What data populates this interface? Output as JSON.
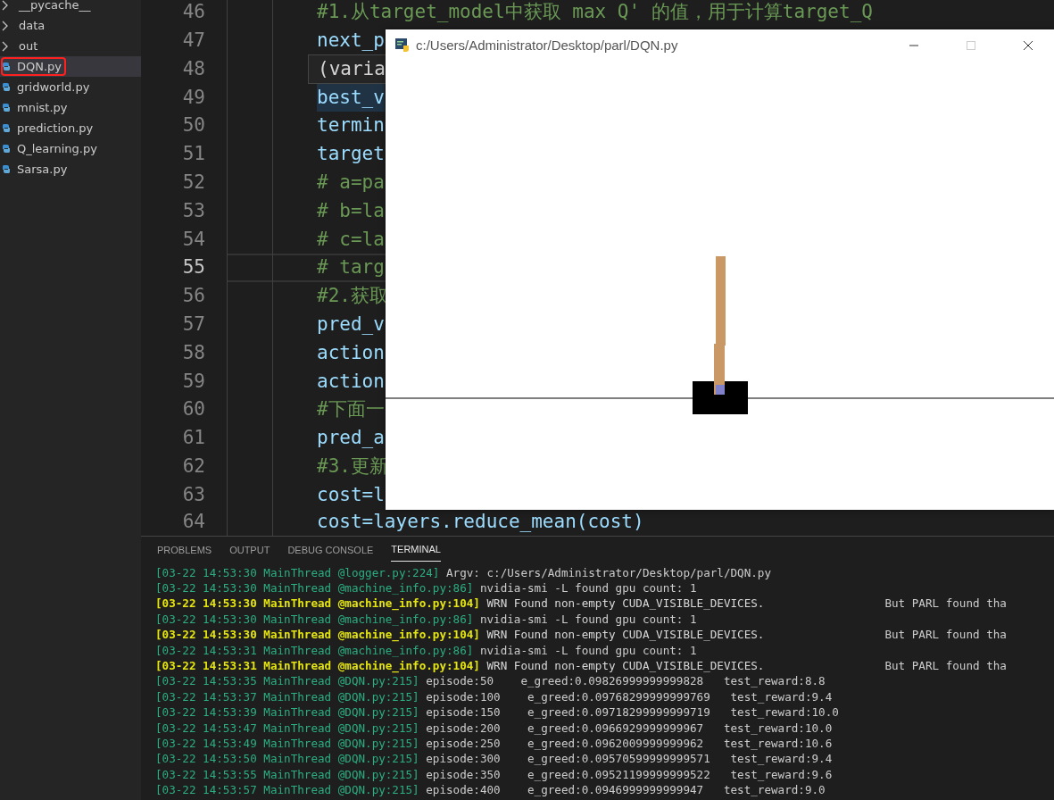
{
  "sidebar": {
    "items": [
      {
        "label": "__pycache__",
        "kind": "folder",
        "selected": false,
        "marked": false
      },
      {
        "label": "data",
        "kind": "folder",
        "selected": false,
        "marked": false
      },
      {
        "label": "out",
        "kind": "folder",
        "selected": false,
        "marked": false
      },
      {
        "label": "DQN.py",
        "kind": "python",
        "selected": true,
        "marked": true
      },
      {
        "label": "gridworld.py",
        "kind": "python",
        "selected": false,
        "marked": false
      },
      {
        "label": "mnist.py",
        "kind": "python",
        "selected": false,
        "marked": false
      },
      {
        "label": "prediction.py",
        "kind": "python",
        "selected": false,
        "marked": false
      },
      {
        "label": "Q_learning.py",
        "kind": "python",
        "selected": false,
        "marked": false
      },
      {
        "label": "Sarsa.py",
        "kind": "python",
        "selected": false,
        "marked": false
      }
    ]
  },
  "editor": {
    "lines": [
      {
        "number": "46",
        "text": "#1.从target_model中获取 max Q' 的值，用于计算target_Q",
        "kind": "comment",
        "highlighted": false,
        "current": false
      },
      {
        "number": "47",
        "text": "next_p",
        "kind": "code",
        "highlighted": false,
        "current": false
      },
      {
        "number": "48",
        "text": "(varia",
        "kind": "hover",
        "highlighted": false,
        "current": false
      },
      {
        "number": "49",
        "text": "best_v",
        "kind": "code",
        "highlighted": true,
        "current": false
      },
      {
        "number": "50",
        "text": "termin",
        "kind": "code",
        "highlighted": false,
        "current": false
      },
      {
        "number": "51",
        "text": "target",
        "kind": "code",
        "highlighted": false,
        "current": false
      },
      {
        "number": "52",
        "text": "# a=pa",
        "kind": "comment",
        "highlighted": false,
        "current": false
      },
      {
        "number": "53",
        "text": "# b=la",
        "kind": "comment",
        "highlighted": false,
        "current": false
      },
      {
        "number": "54",
        "text": "# c=la",
        "kind": "comment",
        "highlighted": false,
        "current": false
      },
      {
        "number": "55",
        "text": "# targ",
        "kind": "comment",
        "highlighted": false,
        "current": true
      },
      {
        "number": "56",
        "text": "#2.获取",
        "kind": "comment",
        "highlighted": false,
        "current": false
      },
      {
        "number": "57",
        "text": "pred_v",
        "kind": "code",
        "highlighted": false,
        "current": false
      },
      {
        "number": "58",
        "text": "action",
        "kind": "code",
        "highlighted": false,
        "current": false
      },
      {
        "number": "59",
        "text": "action",
        "kind": "code",
        "highlighted": false,
        "current": false
      },
      {
        "number": "60",
        "text": "#下面一",
        "kind": "comment",
        "highlighted": false,
        "current": false
      },
      {
        "number": "61",
        "text": "pred_a",
        "kind": "code",
        "highlighted": false,
        "current": false
      },
      {
        "number": "62",
        "text": "#3.更新",
        "kind": "comment",
        "highlighted": false,
        "current": false
      },
      {
        "number": "63",
        "text": "cost=l",
        "kind": "code",
        "highlighted": false,
        "current": false
      },
      {
        "number": "64",
        "text": "cost=layers.reduce_mean(cost)",
        "kind": "code",
        "highlighted": false,
        "current": false
      }
    ]
  },
  "app_window": {
    "title": "c:/Users/Administrator/Desktop/parl/DQN.py"
  },
  "panel": {
    "tabs": [
      {
        "label": "PROBLEMS",
        "selected": false
      },
      {
        "label": "OUTPUT",
        "selected": false
      },
      {
        "label": "DEBUG CONSOLE",
        "selected": false
      },
      {
        "label": "TERMINAL",
        "selected": true
      }
    ],
    "terminal": [
      {
        "kind": "info",
        "prefix": "[03-22 14:53:30 MainThread @logger.py:224]",
        "message": "Argv: c:/Users/Administrator/Desktop/parl/DQN.py"
      },
      {
        "kind": "info",
        "prefix": "[03-22 14:53:30 MainThread @machine_info.py:86]",
        "message": "nvidia-smi -L found gpu count: 1"
      },
      {
        "kind": "warn",
        "prefix": "[03-22 14:53:30 MainThread @machine_info.py:104]",
        "message": "WRN Found non-empty CUDA_VISIBLE_DEVICES.",
        "extra": "But PARL found tha"
      },
      {
        "kind": "info",
        "prefix": "[03-22 14:53:30 MainThread @machine_info.py:86]",
        "message": "nvidia-smi -L found gpu count: 1"
      },
      {
        "kind": "warn",
        "prefix": "[03-22 14:53:30 MainThread @machine_info.py:104]",
        "message": "WRN Found non-empty CUDA_VISIBLE_DEVICES.",
        "extra": "But PARL found tha"
      },
      {
        "kind": "info",
        "prefix": "[03-22 14:53:31 MainThread @machine_info.py:86]",
        "message": "nvidia-smi -L found gpu count: 1"
      },
      {
        "kind": "warn",
        "prefix": "[03-22 14:53:31 MainThread @machine_info.py:104]",
        "message": "WRN Found non-empty CUDA_VISIBLE_DEVICES.",
        "extra": "But PARL found tha"
      },
      {
        "kind": "info",
        "prefix": "[03-22 14:53:35 MainThread @DQN.py:215]",
        "message": "episode:50    e_greed:0.09826999999999828   test_reward:8.8"
      },
      {
        "kind": "info",
        "prefix": "[03-22 14:53:37 MainThread @DQN.py:215]",
        "message": "episode:100    e_greed:0.09768299999999769   test_reward:9.4"
      },
      {
        "kind": "info",
        "prefix": "[03-22 14:53:39 MainThread @DQN.py:215]",
        "message": "episode:150    e_greed:0.09718299999999719   test_reward:10.0"
      },
      {
        "kind": "info",
        "prefix": "[03-22 14:53:47 MainThread @DQN.py:215]",
        "message": "episode:200    e_greed:0.0966929999999967   test_reward:10.0"
      },
      {
        "kind": "info",
        "prefix": "[03-22 14:53:49 MainThread @DQN.py:215]",
        "message": "episode:250    e_greed:0.0962009999999962   test_reward:10.6"
      },
      {
        "kind": "info",
        "prefix": "[03-22 14:53:50 MainThread @DQN.py:215]",
        "message": "episode:300    e_greed:0.09570599999999571   test_reward:9.4"
      },
      {
        "kind": "info",
        "prefix": "[03-22 14:53:55 MainThread @DQN.py:215]",
        "message": "episode:350    e_greed:0.09521199999999522   test_reward:9.6"
      },
      {
        "kind": "info",
        "prefix": "[03-22 14:53:57 MainThread @DQN.py:215]",
        "message": "episode:400    e_greed:0.0946999999999947   test_reward:9.0"
      }
    ]
  }
}
